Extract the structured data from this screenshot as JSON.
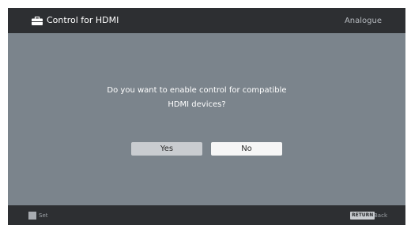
{
  "header": {
    "title": "Control for HDMI",
    "source": "Analogue",
    "icon": "toolbox-icon"
  },
  "dialog": {
    "question_line1": "Do you want to enable control for compatible",
    "question_line2": "HDMI devices?",
    "yes_label": "Yes",
    "no_label": "No",
    "selected": "Yes"
  },
  "footer": {
    "set_label": "Set",
    "return_key": "RETURN",
    "back_label": "Back"
  },
  "colors": {
    "background": "#7b848c",
    "bar": "#2d2f32",
    "selected_button": "#c9ccd0",
    "unselected_button": "#f6f6f6"
  }
}
